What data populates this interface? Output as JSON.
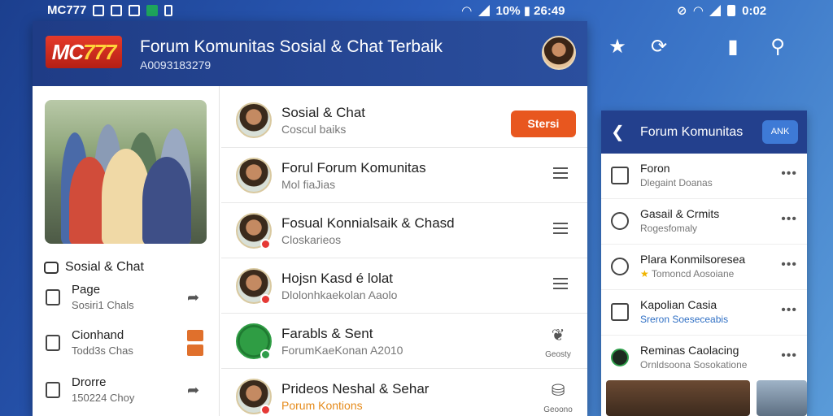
{
  "status_bar": {
    "left_text": "MC777",
    "mid_text": "10% ▮ 26:49",
    "right_text": "0:02"
  },
  "header": {
    "logo": "MC777",
    "title": "Forum Komunitas Sosial & Chat Terbaik",
    "subtitle": "A0093183279"
  },
  "left_column": {
    "section_title": "Sosial & Chat",
    "items": [
      {
        "title": "Page",
        "subtitle": "Sosiri1 Chals"
      },
      {
        "title": "Cionhand",
        "subtitle": "Todd3s Chas"
      },
      {
        "title": "Drorre",
        "subtitle": "150224 Choy"
      }
    ]
  },
  "list": {
    "items": [
      {
        "name": "Sosial & Chat",
        "sub": "Coscul baiks",
        "action": "Stersi"
      },
      {
        "name": "Forul Forum Komunitas",
        "sub": "Mol fiaJias"
      },
      {
        "name": "Fosual Konnialsaik & Chasd",
        "sub": "Closkarieos"
      },
      {
        "name": "Hojsn Kasd é lolat",
        "sub": "Dlolonhkaekolan Aaolo"
      },
      {
        "name": "Farabls & Sent",
        "sub": "ForumKaeKonan A2010",
        "side_label": "Geosty"
      },
      {
        "name": "Prideos Neshal & Sehar",
        "sub": "Porum Kontions",
        "side_label": "Geoono"
      }
    ]
  },
  "right_panel": {
    "title": "Forum Komunitas",
    "button": "ANK",
    "items": [
      {
        "title": "Foron",
        "sub": "Dlegaint Doanas"
      },
      {
        "title": "Gasail & Crmits",
        "sub": "Rogesfomaly"
      },
      {
        "title": "Plara Konmilsoresea",
        "sub": "Tomoncd Aosoiane"
      },
      {
        "title": "Kapolian Casia",
        "sub": "Sreron Soeseceabis"
      },
      {
        "title": "Reminas Caolacing",
        "sub": "Ornldsoona Sosokatione"
      }
    ]
  },
  "colors": {
    "header_bg": "#23408d",
    "accent_orange": "#e8571f",
    "accent_green": "#2e9d4a"
  }
}
